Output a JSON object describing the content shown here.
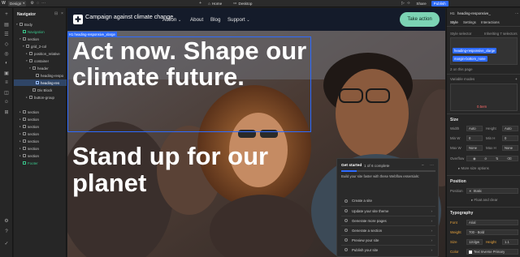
{
  "topbar": {
    "mode_label": "Design",
    "page_label": "Home",
    "breakpoint_label": "Desktop",
    "share_label": "Share",
    "publish_label": "Publish"
  },
  "navigator": {
    "title": "Navigator",
    "rows": [
      {
        "label": "Body"
      },
      {
        "label": "Navigation"
      },
      {
        "label": "section"
      },
      {
        "label": "grid_2-col"
      },
      {
        "label": "position_relative"
      },
      {
        "label": "container"
      },
      {
        "label": "header"
      },
      {
        "label": "heading-respo"
      },
      {
        "label": "heading-res"
      },
      {
        "label": "Div Block"
      },
      {
        "label": "button-group"
      },
      {
        "label": "section"
      },
      {
        "label": "section"
      },
      {
        "label": "section"
      },
      {
        "label": "section"
      },
      {
        "label": "section"
      },
      {
        "label": "section"
      },
      {
        "label": "section"
      },
      {
        "label": "Footer"
      }
    ]
  },
  "site": {
    "title": "Campaign against climate change",
    "menu": [
      "Action",
      "About",
      "Blog",
      "Support"
    ],
    "cta": "Take action",
    "selected_badge": "H1 heading-responsive_xlarge",
    "headline1": "Act now. Shape our climate future.",
    "headline2": "Stand up for our planet"
  },
  "get_started": {
    "title": "Get started",
    "count": "1 of 6 complete",
    "progress": 0.167,
    "subtitle": "Build your site faster with these Webflow essentials:",
    "items": [
      "Create a site",
      "Update your site theme",
      "Generate more pages",
      "Generate a section",
      "Preview your site",
      "Publish your site"
    ]
  },
  "right_panel": {
    "element_label": "heading-responsive_",
    "tabs": [
      "Style",
      "Settings",
      "Interactions"
    ],
    "style_selector_label": "Style selector",
    "inheriting_label": "Inheriting 7 selectors",
    "classes": [
      "heading-responsive_xlarge",
      "margin-bottom_none"
    ],
    "on_page": "2 on this page",
    "variable_modes": "Variable modes",
    "margin_value": "0.5em",
    "size_section": "Size",
    "width_label": "Width",
    "width_val": "Auto",
    "height_label": "Height",
    "height_val": "Auto",
    "minw_label": "Min W",
    "minw_val": "0",
    "minh_label": "Min H",
    "minh_val": "0",
    "maxw_label": "Max W",
    "maxw_val": "None",
    "maxh_label": "Max H",
    "maxh_val": "None",
    "overflow_label": "Overflow",
    "more_size": "More size options",
    "position_section": "Position",
    "position_label": "Position",
    "position_val": "Static",
    "float_label": "Float and clear",
    "typography_section": "Typography",
    "font_label": "Font",
    "font_val": "Arial",
    "weight_label": "Weight",
    "weight_val": "700 - Bold",
    "size_label": "Size",
    "size_val": "12clgw",
    "lheight_label": "Height",
    "lheight_val": "1.1",
    "color_label": "Color",
    "color_val": "Text Inverse Primary"
  },
  "colors": {
    "accent": "#2e6bff",
    "cta": "#7cd3b4",
    "header_bg": "#141b2a"
  }
}
